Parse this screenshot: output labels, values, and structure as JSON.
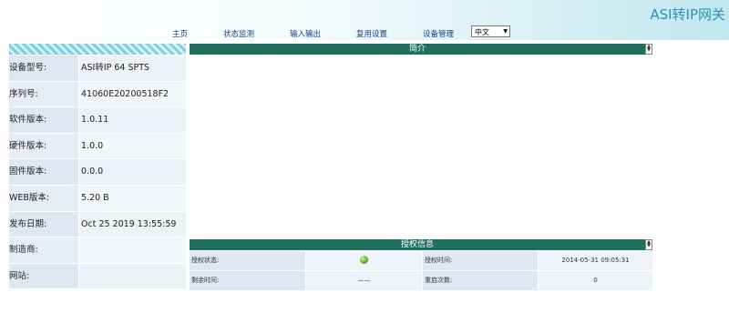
{
  "header": {
    "brand": "ASI转IP网关",
    "nav": [
      {
        "label": "主页"
      },
      {
        "label": "状态监测"
      },
      {
        "label": "输入输出"
      },
      {
        "label": "复用设置"
      },
      {
        "label": "设备管理"
      }
    ],
    "language": {
      "selected": "中文"
    }
  },
  "info": {
    "rows": [
      {
        "label": "设备型号:",
        "value": "ASI转IP 64 SPTS"
      },
      {
        "label": "序列号:",
        "value": "41060E20200518F2"
      },
      {
        "label": "软件版本:",
        "value": "1.0.11"
      },
      {
        "label": "硬件版本:",
        "value": "1.0.0"
      },
      {
        "label": "固件版本:",
        "value": "0.0.0"
      },
      {
        "label": "WEB版本:",
        "value": "5.20 B"
      },
      {
        "label": "发布日期:",
        "value": "Oct 25 2019 13:55:59"
      },
      {
        "label": "制造商:",
        "value": ""
      },
      {
        "label": "网站:",
        "value": ""
      }
    ]
  },
  "intro": {
    "title": "简介"
  },
  "auth": {
    "title": "授权信息",
    "status_label": "授权状态:",
    "status_color": "#62b32a",
    "time_label": "授权时间:",
    "time_value": "2014-05-31 09:05:31",
    "remaining_label": "剩余时间:",
    "remaining_value": "——",
    "restart_label": "重启次数:",
    "restart_value": "0"
  },
  "colors": {
    "section_bar": "#20705f",
    "brand": "#2a93b8",
    "nav_text": "#1a3f8c"
  }
}
